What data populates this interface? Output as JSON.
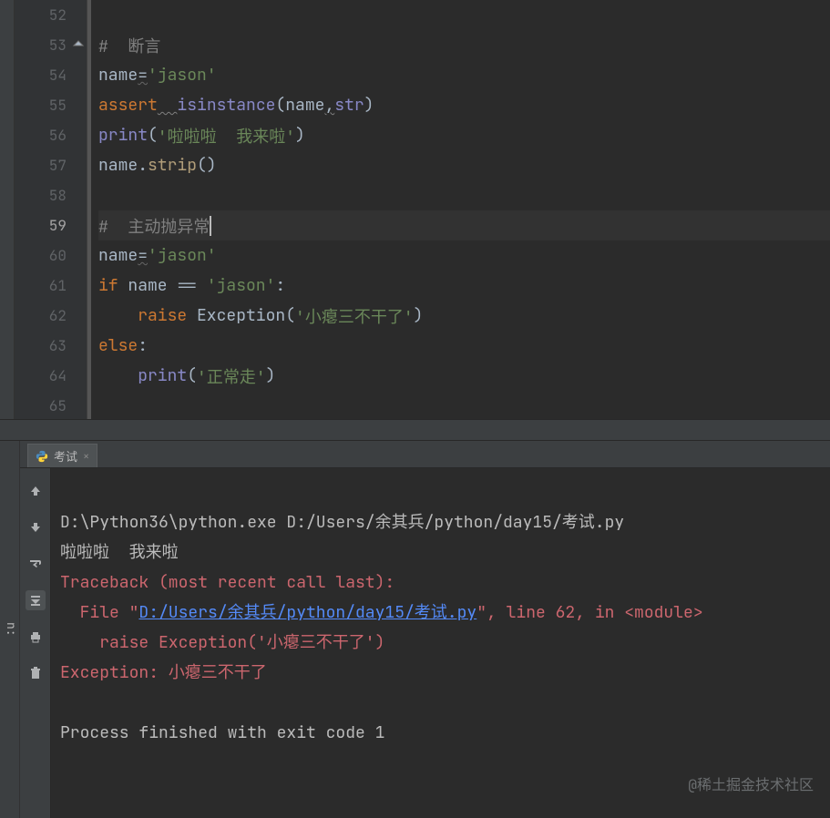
{
  "editor": {
    "gutter": [
      "52",
      "53",
      "54",
      "55",
      "56",
      "57",
      "58",
      "59",
      "60",
      "61",
      "62",
      "63",
      "64",
      "65"
    ],
    "current_line_index": 7,
    "lines": {
      "l53_c": "#  断言",
      "l54_name": "name",
      "l54_eq": "=",
      "l54_val": "'jason'",
      "l55_assert": "assert",
      "l55_isinst": "isinstance",
      "l55_args1": "(name",
      "l55_comma": ",",
      "l55_args2": "str",
      "l55_close": ")",
      "l56_print": "print",
      "l56_open": "(",
      "l56_str": "'啦啦啦  我来啦'",
      "l56_close": ")",
      "l57_name": "name.",
      "l57_strip": "strip",
      "l57_p": "()",
      "l59_c": "#  主动抛异常",
      "l60_name": "name",
      "l60_eq": "=",
      "l60_val": "'jason'",
      "l61_if": "if",
      "l61_cond": " name == ",
      "l61_str": "'jason'",
      "l61_colon": ":",
      "l62_raise": "raise",
      "l62_exc": " Exception(",
      "l62_str": "'小瘪三不干了'",
      "l62_close": ")",
      "l63_else": "else",
      "l63_colon": ":",
      "l64_print": "print",
      "l64_open": "(",
      "l64_str": "'正常走'",
      "l64_close": ")"
    },
    "indent1": "",
    "indent2": "    "
  },
  "run": {
    "label": "n:",
    "tab_name": "考试",
    "cmd": "D:\\Python36\\python.exe D:/Users/余其兵/python/day15/考试.py",
    "out1": "啦啦啦  我来啦",
    "tb1": "Traceback (most recent call last):",
    "tb2a": "  File \"",
    "tb2link": "D:/Users/余其兵/python/day15/考试.py",
    "tb2b": "\", line 62, in <module>",
    "tb3": "    raise Exception('小瘪三不干了')",
    "tb4a": "Exception: ",
    "tb4b": "小瘪三不干了",
    "exit": "Process finished with exit code 1"
  },
  "watermark": "@稀土掘金技术社区"
}
